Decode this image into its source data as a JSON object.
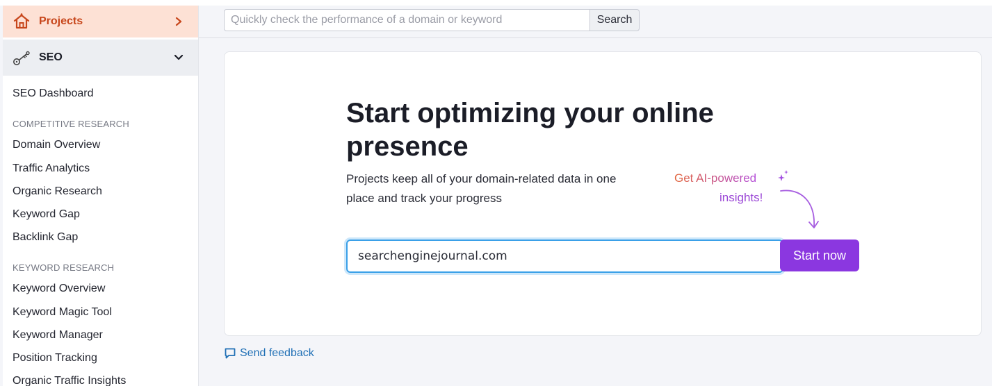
{
  "sidebar": {
    "projects": {
      "label": "Projects",
      "icon": "home-icon"
    },
    "seo": {
      "label": "SEO",
      "icon": "seo-key-icon"
    },
    "items": [
      {
        "label": "SEO Dashboard"
      },
      {
        "section": "COMPETITIVE RESEARCH"
      },
      {
        "label": "Domain Overview"
      },
      {
        "label": "Traffic Analytics"
      },
      {
        "label": "Organic Research"
      },
      {
        "label": "Keyword Gap"
      },
      {
        "label": "Backlink Gap"
      },
      {
        "section": "KEYWORD RESEARCH"
      },
      {
        "label": "Keyword Overview"
      },
      {
        "label": "Keyword Magic Tool"
      },
      {
        "label": "Keyword Manager"
      },
      {
        "label": "Position Tracking"
      },
      {
        "label": "Organic Traffic Insights"
      }
    ]
  },
  "search": {
    "placeholder": "Quickly check the performance of a domain or keyword",
    "button_label": "Search"
  },
  "main": {
    "headline": "Start optimizing your online presence",
    "subtext": "Projects keep all of your domain-related data in one place and track your progress",
    "ai_line1": "Get AI-powered",
    "ai_line2": "insights!",
    "domain_value": "searchenginejournal.com",
    "start_label": "Start now"
  },
  "feedback": {
    "label": "Send feedback"
  },
  "colors": {
    "accent_orange": "#c7461b",
    "projects_bg": "#fde1d5",
    "primary_purple": "#8b37e0",
    "link_blue": "#1f6fb5",
    "input_focus": "#3aa0e8"
  }
}
